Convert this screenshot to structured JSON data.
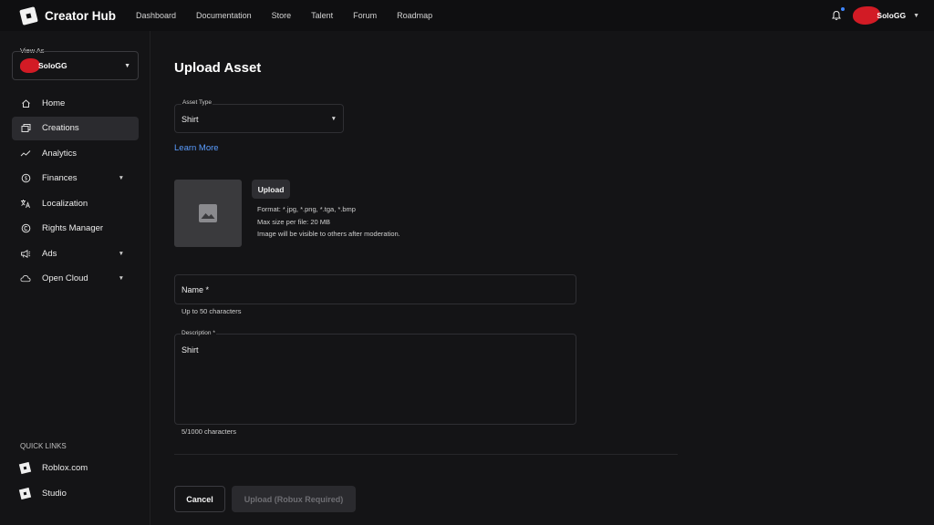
{
  "header": {
    "app_title": "Creator Hub",
    "nav": [
      "Dashboard",
      "Documentation",
      "Store",
      "Talent",
      "Forum",
      "Roadmap"
    ],
    "user_name": "SoloGG",
    "accent_color": "#3f86ff"
  },
  "sidebar": {
    "view_as_label": "View As",
    "view_as_value": "SoloGG",
    "items": [
      {
        "label": "Home",
        "icon": "home-icon"
      },
      {
        "label": "Creations",
        "icon": "creations-icon"
      },
      {
        "label": "Analytics",
        "icon": "analytics-icon"
      },
      {
        "label": "Finances",
        "icon": "finances-icon"
      },
      {
        "label": "Localization",
        "icon": "localization-icon"
      },
      {
        "label": "Rights Manager",
        "icon": "copyright-icon"
      },
      {
        "label": "Ads",
        "icon": "megaphone-icon"
      },
      {
        "label": "Open Cloud",
        "icon": "cloud-icon"
      }
    ],
    "quick_links_title": "QUICK LINKS",
    "quick_links": [
      {
        "label": "Roblox.com"
      },
      {
        "label": "Studio"
      }
    ]
  },
  "main": {
    "title": "Upload Asset",
    "asset_type": {
      "label": "Asset Type",
      "value": "Shirt"
    },
    "learn_more": "Learn More",
    "upload_button": "Upload",
    "upload_info": [
      "Format: *.jpg, *.png, *.tga, *.bmp",
      "Max size per file: 20 MB",
      "Image will be visible to others after moderation."
    ],
    "name_field": {
      "label": "Name *",
      "helper": "Up to 50 characters"
    },
    "description_field": {
      "label": "Description *",
      "value": "Shirt",
      "helper": "5/1000 characters"
    },
    "cancel_button": "Cancel",
    "submit_button": "Upload (Robux Required)"
  }
}
